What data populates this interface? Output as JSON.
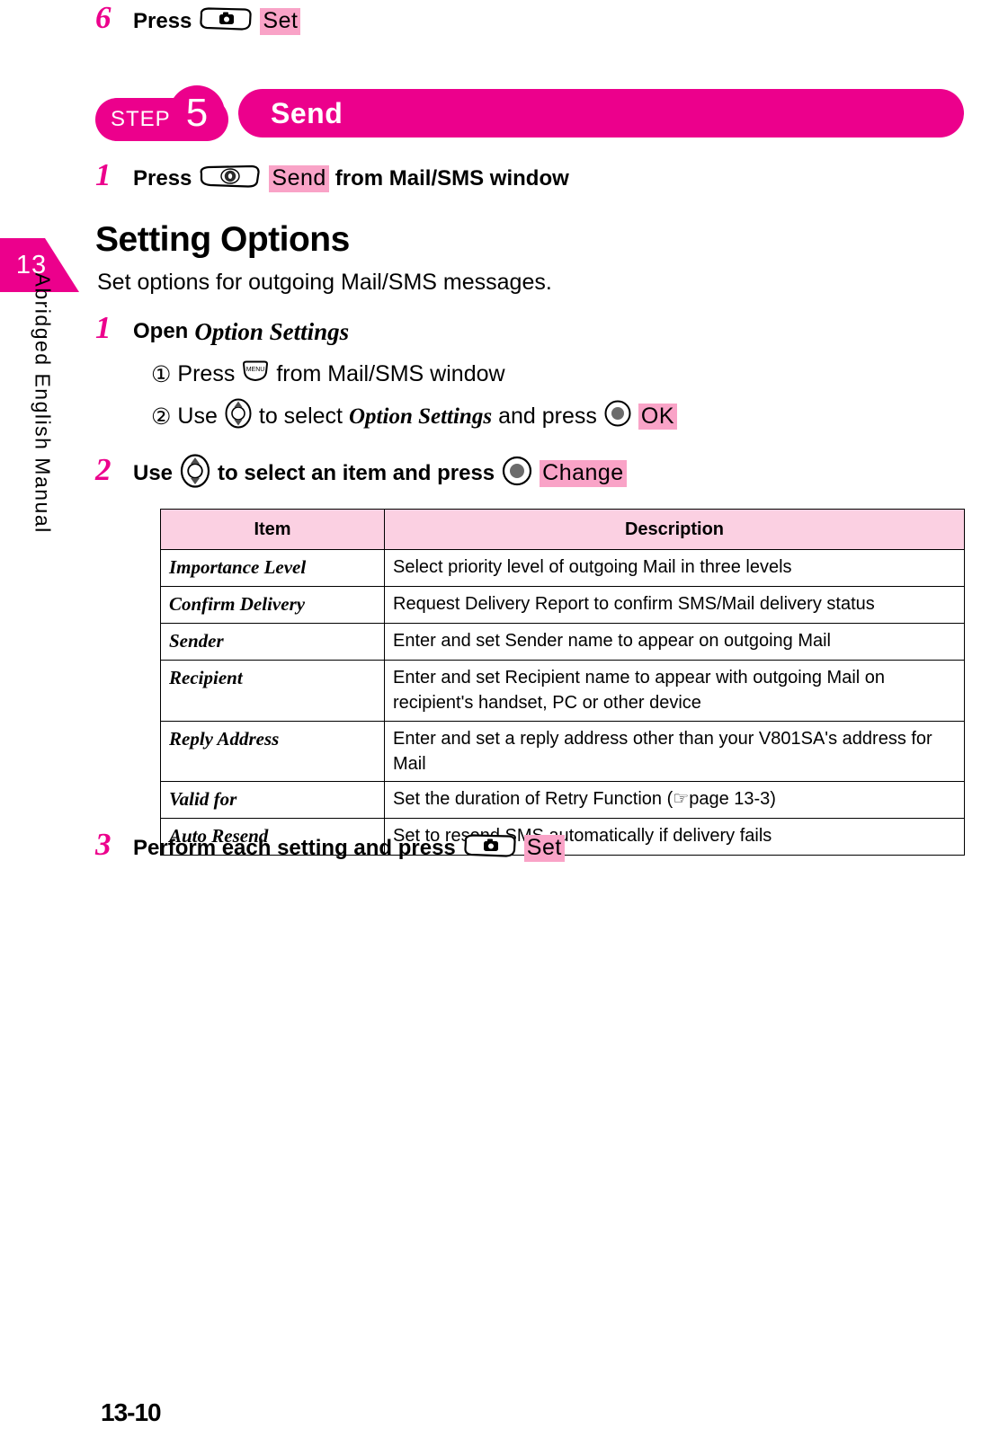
{
  "sidebar": {
    "chapter_number": "13",
    "label": "Abridged English Manual"
  },
  "page_number": "13-10",
  "top_step": {
    "number": "6",
    "verb": "Press",
    "key_icon": "left-softkey-camera-icon",
    "softkey_label": "Set"
  },
  "step_banner": {
    "step_word": "STEP",
    "step_number": "5",
    "title": "Send"
  },
  "send_step": {
    "number": "1",
    "verb": "Press",
    "key_icon": "send-key-icon",
    "softkey_label": "Send",
    "suffix": "from Mail/SMS window"
  },
  "section": {
    "heading": "Setting Options",
    "intro": "Set options for outgoing Mail/SMS messages."
  },
  "step1": {
    "number": "1",
    "title_plain": "Open",
    "title_italic": "Option Settings",
    "sub1": {
      "marker": "①",
      "verb": "Press",
      "key_icon": "menu-key-icon",
      "suffix": "from Mail/SMS window"
    },
    "sub2": {
      "marker": "②",
      "verb": "Use",
      "key_icon": "navigation-updown-key-icon",
      "mid": "to select",
      "italic": "Option Settings",
      "mid2": "and press",
      "center_key_icon": "center-select-key-icon",
      "softkey_label": "OK"
    }
  },
  "step2": {
    "number": "2",
    "verb": "Use",
    "key_icon": "navigation-updown-key-icon",
    "mid": "to select an item and press",
    "center_key_icon": "center-select-key-icon",
    "softkey_label": "Change"
  },
  "table": {
    "headers": [
      "Item",
      "Description"
    ],
    "rows": [
      {
        "item": "Importance Level",
        "description": "Select priority level of outgoing Mail in three levels"
      },
      {
        "item": "Confirm Delivery",
        "description": "Request Delivery Report to confirm SMS/Mail delivery status"
      },
      {
        "item": "Sender",
        "description": "Enter and set Sender name to appear on outgoing Mail"
      },
      {
        "item": "Recipient",
        "description": "Enter and set Recipient name to appear with outgoing Mail on recipient's handset, PC or other device"
      },
      {
        "item": "Reply Address",
        "description": "Enter and set a reply address other than your V801SA's address for Mail"
      },
      {
        "item": "Valid for",
        "description": "Set the duration of Retry Function (☞page 13-3)"
      },
      {
        "item": "Auto Resend",
        "description": "Set to resend SMS automatically if delivery fails"
      }
    ]
  },
  "step3": {
    "number": "3",
    "text": "Perform each setting and press",
    "key_icon": "left-softkey-camera-icon",
    "softkey_label": "Set"
  },
  "colors": {
    "brand_magenta": "#EC008C",
    "highlight_pink": "#F9A3C7",
    "table_header_pink": "#FBD0E2"
  }
}
